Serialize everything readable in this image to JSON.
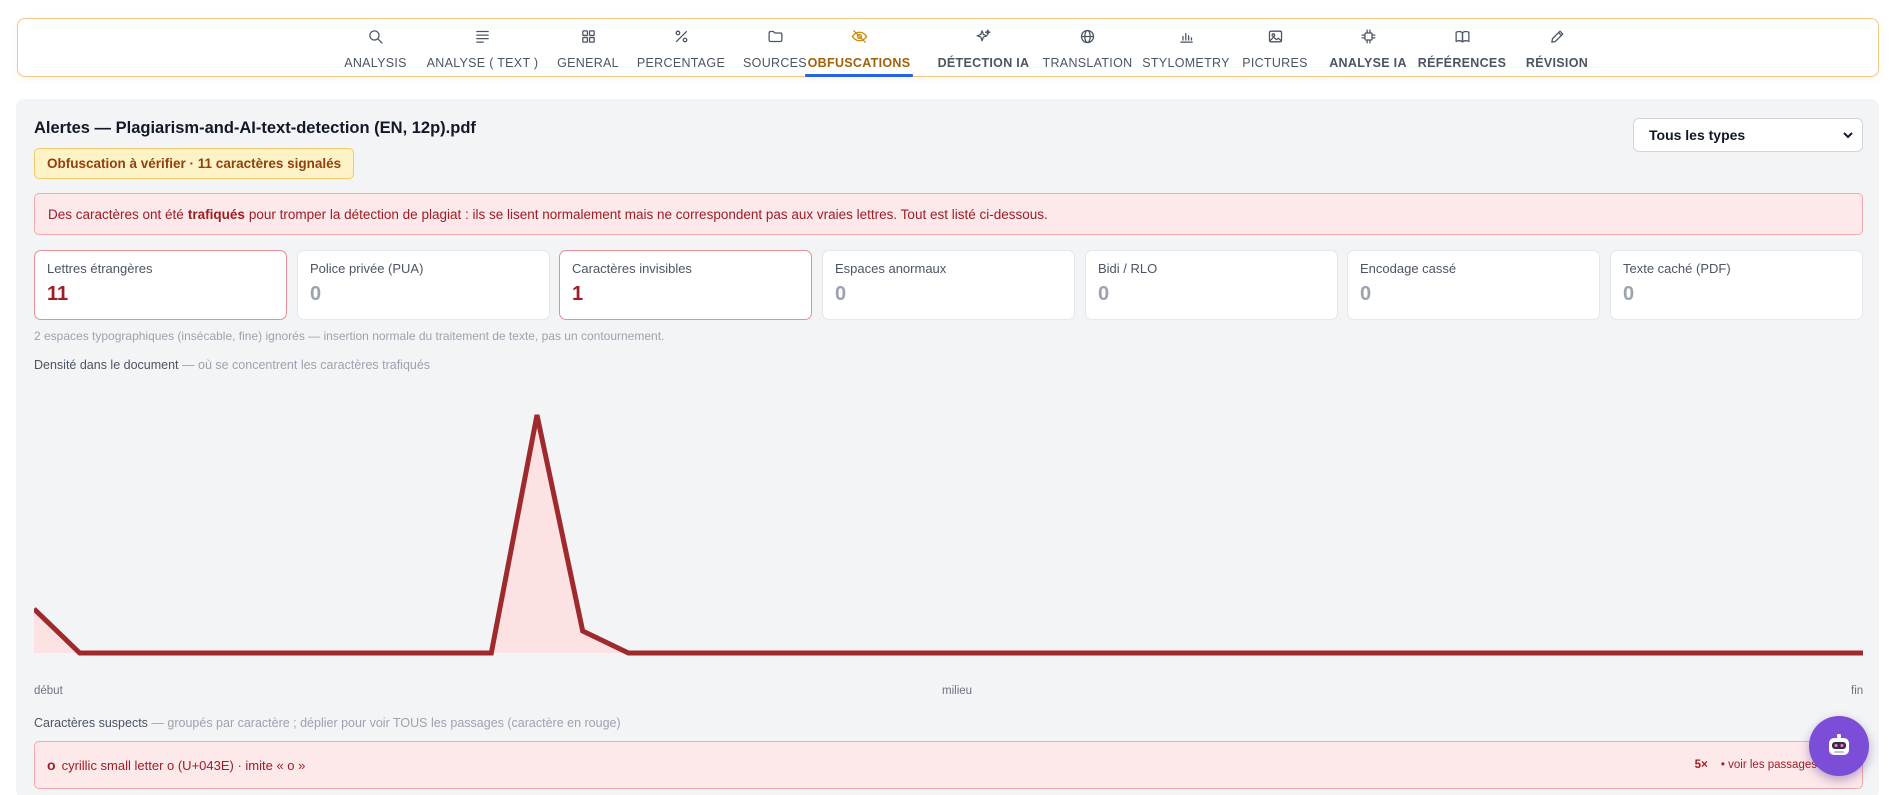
{
  "nav": {
    "tabs": [
      {
        "label": "ANALYSIS",
        "icon": "search-icon"
      },
      {
        "label": "ANALYSE ( TEXT )",
        "icon": "text-lines-icon"
      },
      {
        "label": "GENERAL",
        "icon": "grid-icon"
      },
      {
        "label": "PERCENTAGE",
        "icon": "percent-icon"
      },
      {
        "label": "SOURCES",
        "icon": "folder-icon"
      },
      {
        "label": "OBFUSCATIONS",
        "icon": "eye-off-icon"
      },
      {
        "label": "DÉTECTION IA",
        "icon": "sparkles-icon"
      },
      {
        "label": "TRANSLATION",
        "icon": "globe-icon"
      },
      {
        "label": "STYLOMETRY",
        "icon": "bar-chart-icon"
      },
      {
        "label": "PICTURES",
        "icon": "image-icon"
      },
      {
        "label": "ANALYSE IA",
        "icon": "chip-icon"
      },
      {
        "label": "RÉFÉRENCES",
        "icon": "book-icon"
      },
      {
        "label": "RÉVISION",
        "icon": "pencil-icon"
      }
    ],
    "active": "OBFUSCATIONS"
  },
  "alerts": {
    "title": "Alertes — Plagiarism-and-AI-text-detection (EN, 12p).pdf",
    "type_filter": "Tous les types",
    "badge": "Obfuscation à vérifier · 11 caractères signalés",
    "banner": {
      "before": "Des caractères ont été",
      "bold": "trafiqués",
      "after": "pour tromper la détection de plagiat : ils se lisent normalement mais ne correspondent pas aux vraies lettres. Tout est listé ci-dessous."
    }
  },
  "cards": [
    {
      "label": "Lettres étrangères",
      "value": "11"
    },
    {
      "label": "Police privée (PUA)",
      "value": "0"
    },
    {
      "label": "Caractères invisibles",
      "value": "1"
    },
    {
      "label": "Espaces anormaux",
      "value": "0"
    },
    {
      "label": "Bidi / RLO",
      "value": "0"
    },
    {
      "label": "Encodage cassé",
      "value": "0"
    },
    {
      "label": "Texte caché (PDF)",
      "value": "0"
    }
  ],
  "note": "2 espaces typographiques (insécable, fine) ignorés — insertion normale du traitement de texte, pas un contournement.",
  "density": {
    "label": "Densité dans le document",
    "sublabel": "— où se concentrent les caractères trafiqués"
  },
  "chart_data": {
    "type": "area",
    "x_labels": [
      "début",
      "milieu",
      "fin"
    ],
    "values": [
      1,
      0,
      0,
      0,
      0,
      0,
      0,
      0,
      0,
      0,
      0,
      5.4,
      0.5,
      0,
      0,
      0,
      0,
      0,
      0,
      0,
      0,
      0,
      0,
      0,
      0,
      0,
      0,
      0,
      0,
      0,
      0,
      0,
      0,
      0,
      0,
      0,
      0,
      0,
      0,
      0,
      0
    ],
    "ylim": [
      0,
      5.4
    ],
    "colors": {
      "line": "#9f2a2e",
      "fill": "#fde2e4"
    }
  },
  "suspects": {
    "label": "Caractères suspects",
    "sublabel": "— groupés par caractère ; déplier pour voir TOUS les passages (caractère en rouge)",
    "items": [
      {
        "char": "о",
        "desc": "cyrillic small letter o (U+043E) · imite « o »",
        "count": "5×",
        "link": "• voir les passages"
      }
    ]
  },
  "colors": {
    "accent": "#ca8a04",
    "danger": "#9f1d24",
    "tab_underline": "#2563eb",
    "fab": "#7c4dd6"
  }
}
